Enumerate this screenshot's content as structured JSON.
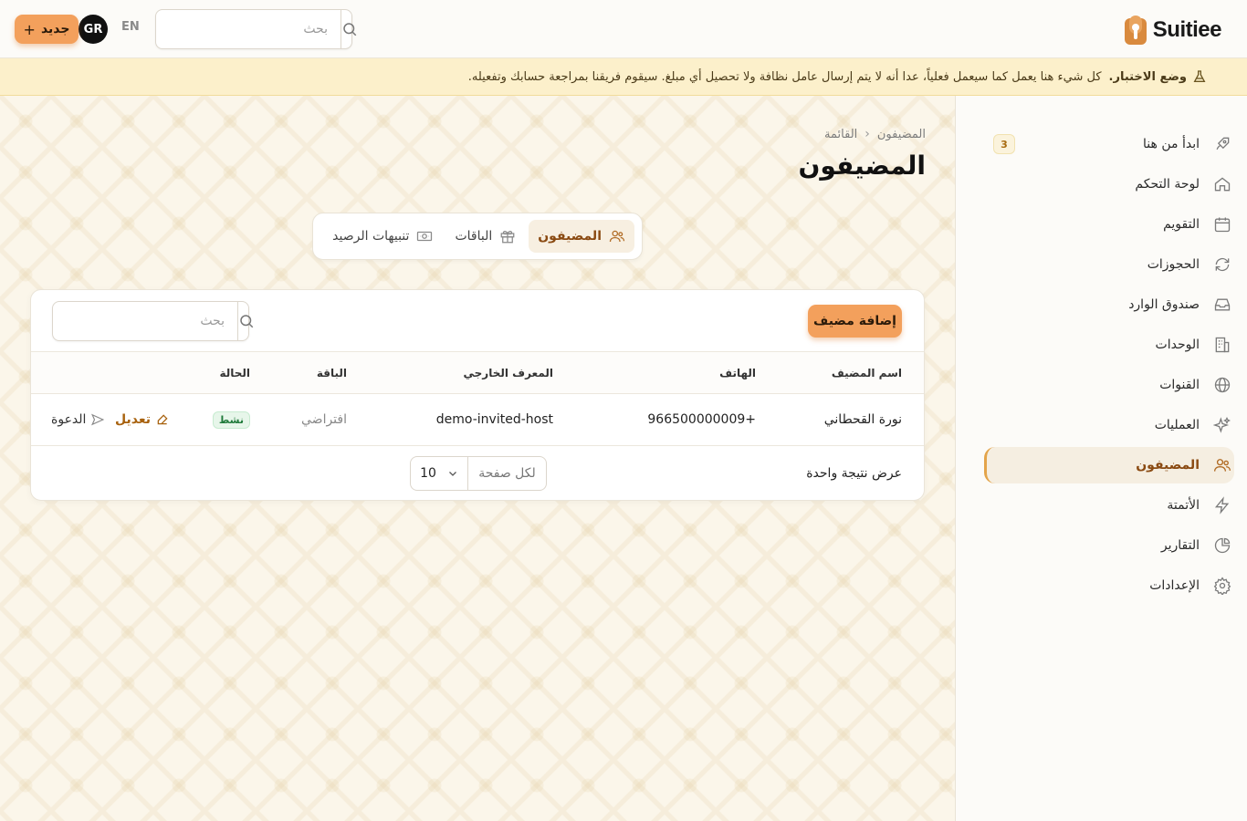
{
  "header": {
    "logo_text": "Suitiee",
    "new_button_label": "جديد",
    "avatar_initials": "GR",
    "language_toggle": "EN",
    "search_placeholder": "بحث"
  },
  "banner": {
    "title": "وضع الاختبار.",
    "message": "كل شيء هنا يعمل كما سيعمل فعلياً، عدا أنه لا يتم إرسال عامل نظافة ولا تحصيل أي مبلغ. سيقوم فريقنا بمراجعة حسابك وتفعيله."
  },
  "sidebar": {
    "items": [
      {
        "label": "ابدأ من هنا",
        "icon": "rocket-icon",
        "badge": "3"
      },
      {
        "label": "لوحة التحكم",
        "icon": "home-icon"
      },
      {
        "label": "التقويم",
        "icon": "calendar-icon"
      },
      {
        "label": "الحجوزات",
        "icon": "refresh-icon"
      },
      {
        "label": "صندوق الوارد",
        "icon": "inbox-icon"
      },
      {
        "label": "الوحدات",
        "icon": "building-icon"
      },
      {
        "label": "القنوات",
        "icon": "globe-icon"
      },
      {
        "label": "العمليات",
        "icon": "sparkles-icon"
      },
      {
        "label": "المضيفون",
        "icon": "users-icon",
        "active": true
      },
      {
        "label": "الأتمتة",
        "icon": "lightning-icon"
      },
      {
        "label": "التقارير",
        "icon": "pie-chart-icon"
      },
      {
        "label": "الإعدادات",
        "icon": "gear-icon"
      }
    ]
  },
  "breadcrumb": {
    "root": "المضيفون",
    "current": "القائمة"
  },
  "page_title": "المضيفون",
  "tabs": [
    {
      "label": "المضيفون",
      "icon": "users-icon",
      "active": true
    },
    {
      "label": "الباقات",
      "icon": "gift-icon"
    },
    {
      "label": "تنبيهات الرصيد",
      "icon": "banknote-icon"
    }
  ],
  "table": {
    "add_button_label": "إضافة مضيف",
    "search_placeholder": "بحث",
    "columns": {
      "name": "اسم المضيف",
      "phone": "الهاتف",
      "external_id": "المعرف الخارجي",
      "plan": "الباقة",
      "status": "الحالة"
    },
    "rows": [
      {
        "name": "نورة القحطاني",
        "phone": "966500000009+",
        "external_id": "demo-invited-host",
        "plan": "افتراضي",
        "status": "نشط",
        "edit_label": "تعديل",
        "invite_label": "الدعوة"
      }
    ],
    "results_text": "عرض نتيجة واحدة",
    "per_page_label": "لكل صفحة",
    "per_page_value": "10"
  },
  "colors": {
    "accent": "#f3a05c",
    "accent_text": "#a8620f",
    "banner_bg": "#fcf0cb",
    "status_green": "#1f7a3a"
  }
}
